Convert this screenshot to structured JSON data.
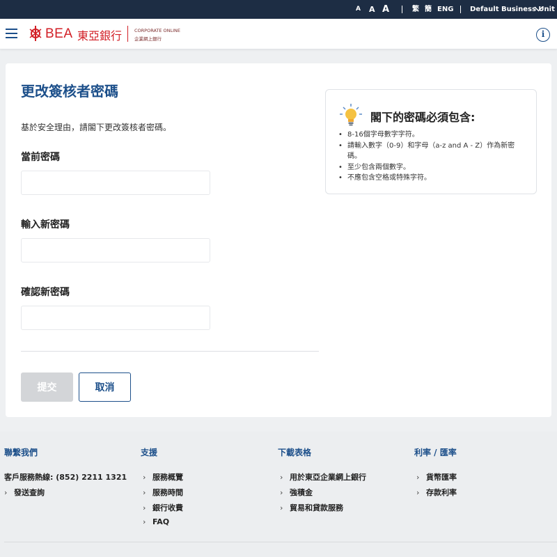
{
  "topbar": {
    "font_sizes": [
      "A",
      "A",
      "A"
    ],
    "lang_trad": "繁",
    "lang_simp": "簡",
    "lang_eng": "ENG",
    "business_unit": "Default Business Unit"
  },
  "header": {
    "logo_en": "BEA",
    "logo_zh": "東亞銀行",
    "logo_sub1": "CORPORATE ONLINE",
    "logo_sub2": "企業網上銀行",
    "info_glyph": "i"
  },
  "form": {
    "title": "更改簽核者密碼",
    "intro": "基於安全理由，請閣下更改簽核者密碼。",
    "current_label": "當前密碼",
    "new_label": "輸入新密碼",
    "confirm_label": "確認新密碼",
    "current_value": "",
    "new_value": "",
    "confirm_value": "",
    "submit": "提交",
    "cancel": "取消"
  },
  "tips": {
    "title": "閣下的密碼必須包含:",
    "items": [
      "8-16個字母數字字符。",
      "請輸入數字（0-9）和字母（a-z and A - Z）作為新密碼。",
      "至少包含兩個數字。",
      "不應包含空格或特殊字符。"
    ]
  },
  "footer": {
    "contact_title": "聯繫我們",
    "hotline": "客戶服務熱線: (852) 2211 1321",
    "contact_link": "發送查詢",
    "support_title": "支援",
    "support_links": [
      "服務概覽",
      "服務時間",
      "銀行收費",
      "FAQ"
    ],
    "download_title": "下載表格",
    "download_links": [
      "用於東亞企業網上銀行",
      "強積金",
      "貿易和貸款服務"
    ],
    "rates_title": "利率 / 匯率",
    "rates_links": [
      "貨幣匯率",
      "存款利率"
    ]
  },
  "colors": {
    "brand_red": "#d21f26",
    "primary_blue": "#1c4f8a",
    "topbar_bg": "#1d2d44"
  }
}
